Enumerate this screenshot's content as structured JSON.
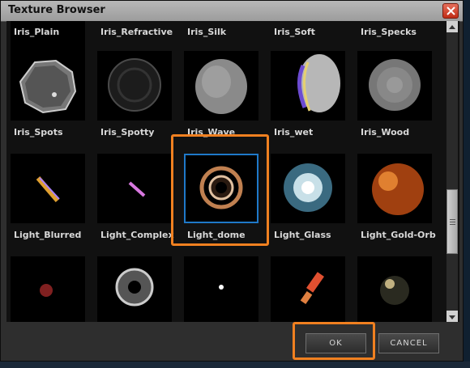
{
  "window": {
    "title": "Texture Browser"
  },
  "rows": [
    {
      "labels": [
        "Iris_Plain",
        "Iris_Refractive",
        "Iris_Silk",
        "Iris_Soft",
        "Iris_Specks"
      ]
    },
    {
      "labels": [
        "Iris_Spots",
        "Iris_Spotty",
        "Iris_Wave",
        "Iris_wet",
        "Iris_Wood"
      ]
    },
    {
      "labels": [
        "Light_Blurred",
        "Light_Complex",
        "Light_dome",
        "Light_Glass",
        "Light_Gold-Orb"
      ]
    },
    {
      "labels": [
        "",
        "",
        "",
        "",
        ""
      ]
    }
  ],
  "selected_texture": "Light_dome",
  "buttons": {
    "ok": "OK",
    "cancel": "CANCEL"
  },
  "colors": {
    "highlight": "#f08020",
    "selection": "#1f79c9"
  }
}
